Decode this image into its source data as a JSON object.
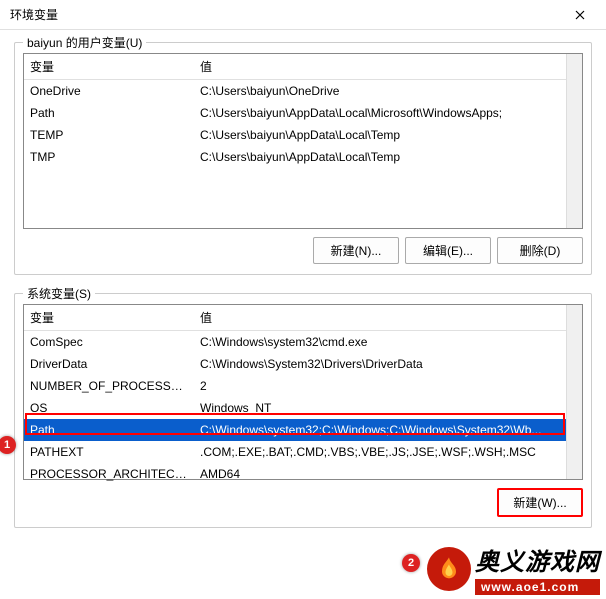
{
  "window": {
    "title": "环境变量"
  },
  "user_section": {
    "label": "baiyun 的用户变量(U)",
    "columns": {
      "var": "变量",
      "val": "值"
    },
    "rows": [
      {
        "var": "OneDrive",
        "val": "C:\\Users\\baiyun\\OneDrive"
      },
      {
        "var": "Path",
        "val": "C:\\Users\\baiyun\\AppData\\Local\\Microsoft\\WindowsApps;"
      },
      {
        "var": "TEMP",
        "val": "C:\\Users\\baiyun\\AppData\\Local\\Temp"
      },
      {
        "var": "TMP",
        "val": "C:\\Users\\baiyun\\AppData\\Local\\Temp"
      }
    ],
    "buttons": {
      "new": "新建(N)...",
      "edit": "编辑(E)...",
      "delete": "删除(D)"
    }
  },
  "sys_section": {
    "label": "系统变量(S)",
    "columns": {
      "var": "变量",
      "val": "值"
    },
    "rows": [
      {
        "var": "ComSpec",
        "val": "C:\\Windows\\system32\\cmd.exe"
      },
      {
        "var": "DriverData",
        "val": "C:\\Windows\\System32\\Drivers\\DriverData"
      },
      {
        "var": "NUMBER_OF_PROCESSORS",
        "val": "2"
      },
      {
        "var": "OS",
        "val": "Windows_NT"
      },
      {
        "var": "Path",
        "val": "C:\\Windows\\system32;C:\\Windows;C:\\Windows\\System32\\Wb..."
      },
      {
        "var": "PATHEXT",
        "val": ".COM;.EXE;.BAT;.CMD;.VBS;.VBE;.JS;.JSE;.WSF;.WSH;.MSC"
      },
      {
        "var": "PROCESSOR_ARCHITECT...",
        "val": "AMD64"
      }
    ],
    "selected_index": 4,
    "buttons": {
      "new": "新建(W)..."
    }
  },
  "annotations": {
    "badge1": "1",
    "badge2": "2"
  },
  "brand": {
    "title": "奥义游戏网",
    "url": "www.aoe1.com"
  }
}
